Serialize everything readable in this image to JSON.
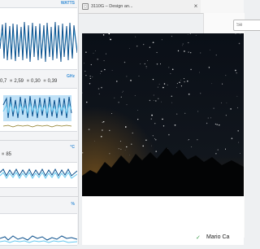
{
  "monitor": {
    "panels": [
      {
        "unit": "WATTS"
      },
      {
        "unit": "GHz",
        "values": [
          "0,7",
          "2,59",
          "0,30",
          "0,39"
        ]
      },
      {
        "unit": "°C",
        "value": "85"
      },
      {
        "unit": "%"
      }
    ]
  },
  "browser": {
    "tab_title": "3110G – Design an...",
    "close_glyph": "×",
    "search_placeholder": "Se",
    "credit_name": "Mario Ca",
    "check_glyph": "✓"
  },
  "colors": {
    "accent": "#2f8fe0",
    "line_dark": "#0a4f8c",
    "line_light": "#64c8f0",
    "fill": "#bfe1f7"
  }
}
